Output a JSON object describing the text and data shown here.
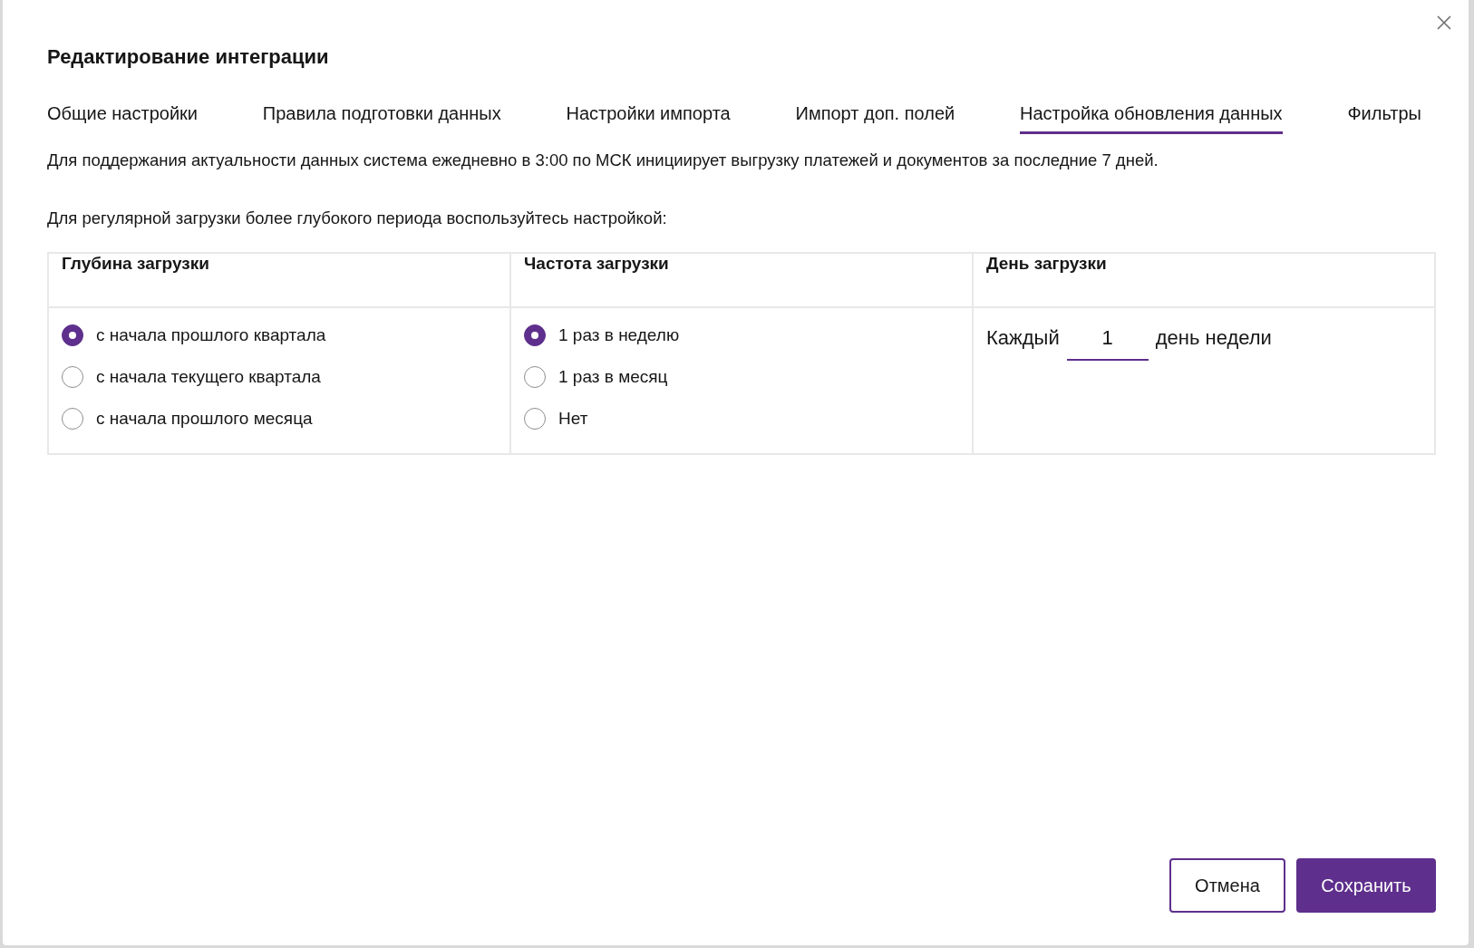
{
  "dialog": {
    "title": "Редактирование интеграции"
  },
  "tabs": [
    {
      "label": "Общие настройки",
      "selected": false
    },
    {
      "label": "Правила подготовки данных",
      "selected": false
    },
    {
      "label": "Настройки импорта",
      "selected": false
    },
    {
      "label": "Импорт доп. полей",
      "selected": false
    },
    {
      "label": "Настройка обновления данных",
      "selected": true
    },
    {
      "label": "Фильтры",
      "selected": false
    }
  ],
  "paragraphs": [
    "Для поддержания актуальности данных система ежедневно в 3:00 по МСК инициирует выгрузку платежей и документов за последние 7 дней.",
    "Для регулярной загрузки более глубокого периода воспользуйтесь настройкой:"
  ],
  "table": {
    "columns": [
      {
        "header": "Глубина загрузки",
        "kind": "radio",
        "options": [
          {
            "label": "с начала прошлого квартала",
            "selected": true
          },
          {
            "label": "с начала текущего квартала",
            "selected": false
          },
          {
            "label": "с начала прошлого месяца",
            "selected": false
          }
        ]
      },
      {
        "header": "Частота загрузки",
        "kind": "radio",
        "options": [
          {
            "label": "1 раз в неделю",
            "selected": true
          },
          {
            "label": "1 раз в месяц",
            "selected": false
          },
          {
            "label": "Нет",
            "selected": false
          }
        ]
      },
      {
        "header": "День загрузки",
        "kind": "day",
        "prefix": "Каждый",
        "value": "1",
        "suffix": "день недели"
      }
    ]
  },
  "buttons": [
    {
      "label": "Отмена",
      "kind": "secondary"
    },
    {
      "label": "Сохранить",
      "kind": "primary"
    }
  ]
}
